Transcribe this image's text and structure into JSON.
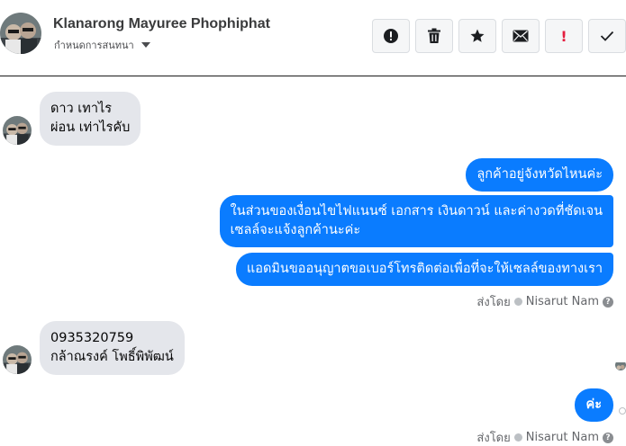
{
  "header": {
    "name": "Klanarong Mayuree Phophiphat",
    "subtitle": "กำหนดการสนทนา"
  },
  "toolbar": {
    "buttons": [
      {
        "icon": "alert-circle-icon"
      },
      {
        "icon": "trash-icon"
      },
      {
        "icon": "star-icon"
      },
      {
        "icon": "envelope-icon"
      },
      {
        "icon": "exclamation-icon",
        "label": "!"
      },
      {
        "icon": "checkmark-icon"
      }
    ]
  },
  "messages": {
    "m1": {
      "line1": "ดาว เทาไร",
      "line2": "ผ่อน เท่าไรคับ"
    },
    "m2": {
      "text": "ลูกค้าอยู่จังหวัดไหนค่ะ"
    },
    "m3": {
      "line1": "ในส่วนของเงื่อนไขไฟแนนซ์ เอกสาร เงินดาวน์ และค่างวดที่ชัดเจน",
      "line2": "เซลล์จะแจ้งลูกค้านะค่ะ"
    },
    "m4": {
      "text": "แอดมินขออนุญาตขอเบอร์โทรติดต่อเพื่อที่จะให้เซลล์ของทางเรา"
    },
    "m5": {
      "line1": "0935320759",
      "line2": "กล้าณรงค์ โพธิ์พิพัฒน์"
    },
    "m6": {
      "text": "ค่ะ"
    }
  },
  "sent_by": {
    "prefix": "ส่งโดย",
    "name": "Nisarut Nam",
    "help": "?"
  },
  "colors": {
    "outgoing_bubble": "#0a7cff",
    "incoming_bubble": "#e4e6eb",
    "flag_red": "#e41e3f"
  }
}
